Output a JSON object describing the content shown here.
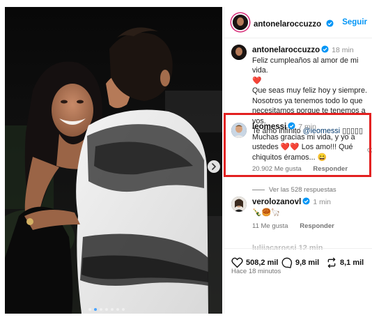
{
  "post": {
    "author": "antonelaroccuzzo",
    "follow_label": "Seguir",
    "carousel_dots": 7,
    "carousel_active": 1
  },
  "caption": {
    "author": "antonelaroccuzzo",
    "time": "18 min",
    "line1": "Feliz cumpleaños al amor de mi vida.",
    "line2_emoji": "❤️",
    "line3": "Que seas muy feliz hoy y siempre. Nosotros ya tenemos todo lo que necesitamos porque te tenemos a vos.",
    "line4_prefix": "Te amo infinito",
    "mention": "@leomessi",
    "line4_suffix": "▯▯▯▯▯"
  },
  "comments": [
    {
      "author": "leomessi",
      "time": "7 min",
      "text": "Muchas gracias mi vida, y yo a ustedes ❤️❤️ Los amo!!! Qué chiquitos éramos... 😄",
      "likes": "20.902 Me gusta",
      "reply_label": "Responder"
    },
    {
      "author": "verolozanovl",
      "time": "1 min",
      "text": "🍾🥮🦙",
      "likes": "11 Me gusta",
      "reply_label": "Responder"
    }
  ],
  "view_replies": "Ver las 528 respuestas",
  "partial_comment": "lulijacarossi 12 min",
  "stats": {
    "likes": "508,2 mil",
    "comments": "9,8 mil",
    "reposts": "8,1 mil"
  },
  "posted_ago": "Hace 18 minutos",
  "colors": {
    "accent": "#0095f6",
    "highlight": "#e32020",
    "heart": "#ed4956"
  }
}
